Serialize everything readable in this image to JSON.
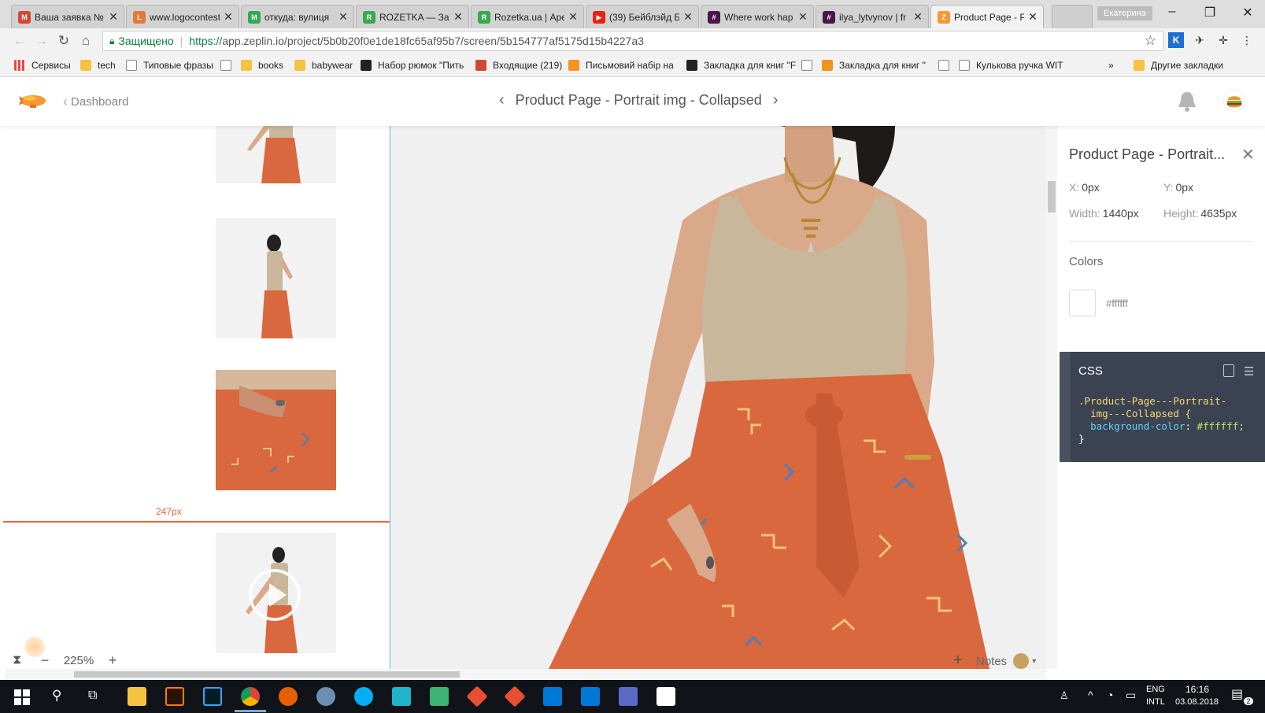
{
  "browser": {
    "tabs": [
      {
        "title": "Ваша заявка №",
        "icon": "gmail-icon",
        "color": "#d14836",
        "glyph": "M"
      },
      {
        "title": "www.logocontest",
        "icon": "logocontest-icon",
        "color": "#e07b39",
        "glyph": "L"
      },
      {
        "title": "откуда: вулиця",
        "icon": "maps-icon",
        "color": "#34a853",
        "glyph": "M"
      },
      {
        "title": "ROZETKA — Зам",
        "icon": "rozetka-icon",
        "color": "#3aa850",
        "glyph": "R"
      },
      {
        "title": "Rozetka.ua | Аре",
        "icon": "rozetka-icon",
        "color": "#3aa850",
        "glyph": "R"
      },
      {
        "title": "(39) Бейблэйд Бу",
        "icon": "youtube-icon",
        "color": "#e62117",
        "glyph": "▶"
      },
      {
        "title": "Where work hap",
        "icon": "slack-icon",
        "color": "#4a154b",
        "glyph": "#"
      },
      {
        "title": "ilya_lytvynov | fr",
        "icon": "slack-icon",
        "color": "#4a154b",
        "glyph": "#"
      },
      {
        "title": "Product Page - P",
        "icon": "zeplin-icon",
        "color": "#f69833",
        "glyph": "Z"
      }
    ],
    "user_badge": "Екатерина",
    "secure_label": "Защищено",
    "url_scheme": "https://",
    "url_rest": "app.zeplin.io/project/5b0b20f0e1de18fc65af95b7/screen/5b154777af5175d15b4227a3",
    "bookmarks": [
      {
        "label": "Сервисы",
        "icon": "apps"
      },
      {
        "label": "tech",
        "icon": "folder"
      },
      {
        "label": "Типовые фразы",
        "icon": "page"
      },
      {
        "label": "",
        "icon": "page"
      },
      {
        "label": "books",
        "icon": "folder"
      },
      {
        "label": "babywear",
        "icon": "folder"
      },
      {
        "label": "Набор рюмок \"Пить",
        "icon": "dark"
      },
      {
        "label": "Входящие (219)",
        "icon": "red"
      },
      {
        "label": "Письмовий набір на",
        "icon": "orange"
      },
      {
        "label": "Закладка для книг \"F",
        "icon": "dark"
      },
      {
        "label": "",
        "icon": "page"
      },
      {
        "label": "Закладка для книг \"",
        "icon": "orange"
      },
      {
        "label": "",
        "icon": "page"
      },
      {
        "label": "Кулькова ручка WIT",
        "icon": "page"
      },
      {
        "label": "»",
        "icon": ""
      },
      {
        "label": "Другие закладки",
        "icon": "folder"
      }
    ]
  },
  "header": {
    "back_label": "Dashboard",
    "screen_title": "Product Page - Portrait img - Collapsed"
  },
  "canvas": {
    "measure_label": "247px",
    "zoom": "225%",
    "notes_label": "Notes"
  },
  "inspector": {
    "title": "Product Page - Portrait...",
    "x_label": "X:",
    "x_value": "0px",
    "y_label": "Y:",
    "y_value": "0px",
    "width_label": "Width:",
    "width_value": "1440px",
    "height_label": "Height:",
    "height_value": "4635px",
    "colors_label": "Colors",
    "color_hex": "#ffffff",
    "css_title": "CSS",
    "css_selector_1": ".Product-Page---Portrait-",
    "css_selector_2": "img---Collapsed {",
    "css_prop": "background-color",
    "css_value": "#ffffff;",
    "css_close": "}"
  },
  "taskbar": {
    "lang": "ENG",
    "layout": "INTL",
    "time": "16:16",
    "date": "03.08.2018",
    "notif_count": "2"
  },
  "colors": {
    "accent_orange": "#e8663d",
    "pants": "#d9683f",
    "top": "#c9b79c",
    "css_bg": "#3b4352"
  }
}
